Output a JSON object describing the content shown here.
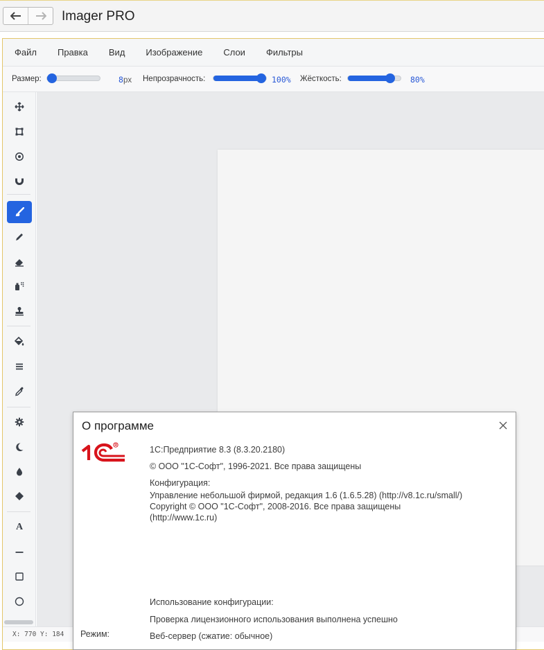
{
  "app": {
    "title": "Imager PRO",
    "nav": {
      "back_icon": "arrow-left-icon",
      "forward_icon": "arrow-right-icon"
    }
  },
  "menu": [
    "Файл",
    "Правка",
    "Вид",
    "Изображение",
    "Слои",
    "Фильтры"
  ],
  "options": {
    "size": {
      "label": "Размер:",
      "value": "8",
      "unit": "px",
      "level": 0.03
    },
    "opacity": {
      "label": "Непрозрачность:",
      "value": "100%",
      "level": 1.0
    },
    "hardness": {
      "label": "Жёсткость:",
      "value": "80%",
      "level": 0.8
    }
  },
  "tools": [
    {
      "name": "move-icon",
      "active": false
    },
    {
      "name": "crop-icon",
      "active": false
    },
    {
      "name": "ellipse-select-icon",
      "active": false
    },
    {
      "name": "magnet-icon",
      "active": false
    },
    {
      "name": "brush-icon",
      "active": true
    },
    {
      "name": "pencil-icon",
      "active": false
    },
    {
      "name": "eraser-icon",
      "active": false
    },
    {
      "name": "spray-icon",
      "active": false
    },
    {
      "name": "stamp-icon",
      "active": false
    },
    {
      "name": "fill-bucket-icon",
      "active": false
    },
    {
      "name": "gradient-icon",
      "active": false
    },
    {
      "name": "eyedropper-icon",
      "active": false
    },
    {
      "name": "gear-icon",
      "active": false
    },
    {
      "name": "moon-icon",
      "active": false
    },
    {
      "name": "drop-icon",
      "active": false
    },
    {
      "name": "diamond-icon",
      "active": false
    },
    {
      "name": "text-tool-icon",
      "active": false,
      "glyph": "A"
    },
    {
      "name": "line-icon",
      "active": false
    },
    {
      "name": "rectangle-icon",
      "active": false
    },
    {
      "name": "circle-icon",
      "active": false
    }
  ],
  "status": {
    "coords": "X: 770 Y: 184"
  },
  "colors": {
    "accent": "#2464e0",
    "logo_red": "#d8131b",
    "frame_border": "#e3c66a"
  },
  "dialog": {
    "title": "О программе",
    "close_icon": "close-icon",
    "logo_icon": "1c-logo-icon",
    "platform": "1С:Предприятие 8.3 (8.3.20.2180)",
    "platform_copyright": "© ООО \"1С-Софт\", 1996-2021. Все права защищены",
    "config_label": "Конфигурация:",
    "config_name": "Управление небольшой фирмой, редакция 1.6 (1.6.5.28) (http://v8.1c.ru/small/)",
    "config_copyright": "Copyright © ООО \"1С-Софт\", 2008-2016. Все права защищены",
    "config_url": "(http://www.1c.ru)",
    "usage_label": "Использование конфигурации:",
    "usage_status": "Проверка лицензионного использования выполнена успешно",
    "mode_label": "Режим:",
    "mode_value": "Веб-сервер (сжатие: обычное)"
  }
}
